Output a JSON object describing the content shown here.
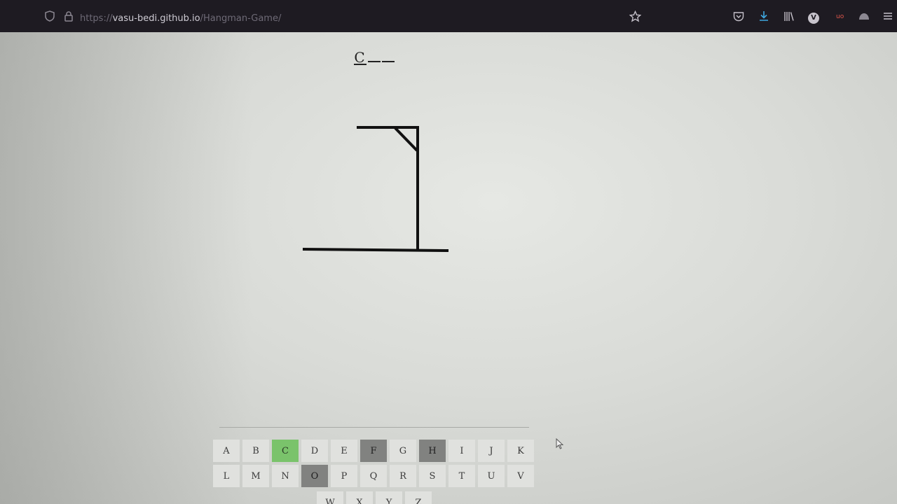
{
  "browser": {
    "url_scheme": "https://",
    "url_host": "vasu-bedi.github.io",
    "url_path": "/Hangman-Game/",
    "profile_initial": "V",
    "extension_badge": "uo"
  },
  "game": {
    "word_slots": [
      "C",
      "",
      ""
    ],
    "gallows_parts": [
      "base",
      "pole",
      "beam",
      "brace"
    ]
  },
  "keyboard": {
    "rows": [
      [
        {
          "letter": "A",
          "state": "unused"
        },
        {
          "letter": "B",
          "state": "unused"
        },
        {
          "letter": "C",
          "state": "correct"
        },
        {
          "letter": "D",
          "state": "unused"
        },
        {
          "letter": "E",
          "state": "unused"
        },
        {
          "letter": "F",
          "state": "wrong"
        },
        {
          "letter": "G",
          "state": "unused"
        },
        {
          "letter": "H",
          "state": "wrong"
        },
        {
          "letter": "I",
          "state": "unused"
        },
        {
          "letter": "J",
          "state": "unused"
        },
        {
          "letter": "K",
          "state": "unused"
        }
      ],
      [
        {
          "letter": "L",
          "state": "unused"
        },
        {
          "letter": "M",
          "state": "unused"
        },
        {
          "letter": "N",
          "state": "unused"
        },
        {
          "letter": "O",
          "state": "wrong"
        },
        {
          "letter": "P",
          "state": "unused"
        },
        {
          "letter": "Q",
          "state": "unused"
        },
        {
          "letter": "R",
          "state": "unused"
        },
        {
          "letter": "S",
          "state": "unused"
        },
        {
          "letter": "T",
          "state": "unused"
        },
        {
          "letter": "U",
          "state": "unused"
        },
        {
          "letter": "V",
          "state": "unused"
        }
      ],
      [
        {
          "letter": "W",
          "state": "unused"
        },
        {
          "letter": "X",
          "state": "unused"
        },
        {
          "letter": "Y",
          "state": "unused"
        },
        {
          "letter": "Z",
          "state": "unused"
        }
      ]
    ]
  },
  "colors": {
    "correct": "#7ac36b",
    "wrong": "#818280",
    "unused": "#e0e1de",
    "gallows": "#111111"
  },
  "icons": [
    "shield-icon",
    "lock-icon",
    "star-icon",
    "pocket-icon",
    "download-icon",
    "library-icon",
    "account-icon",
    "extension-icon",
    "sync-icon",
    "menu-icon"
  ]
}
